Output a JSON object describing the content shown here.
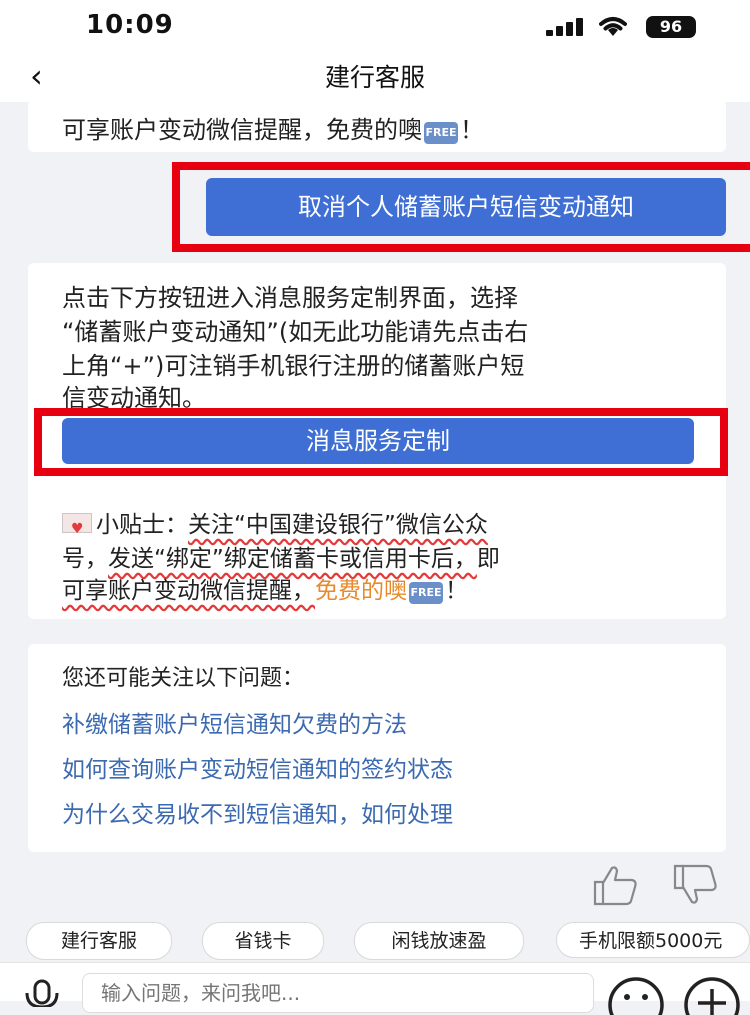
{
  "status": {
    "time": "10:09",
    "battery": "96"
  },
  "nav": {
    "back_icon": "‹",
    "title": "建行客服"
  },
  "card1": {
    "text_a": "可享账户变动微信提醒，免费的噢",
    "free_icon": "FREE",
    "text_b": "！"
  },
  "user_msg": {
    "label": "取消个人储蓄账户短信变动通知"
  },
  "card2": {
    "lines": [
      "点击下方按钮进入消息服务定制界面，选择",
      "“储蓄账户变动通知”(如无此功能请先点击右",
      "上角“+”)可注销手机银行注册的储蓄账户短",
      "信变动通知。"
    ],
    "button": "消息服务定制",
    "tip_prefix": "小贴士：",
    "tip_1": "关注“中国建设银行”微信公众",
    "tip_2a": "号，",
    "tip_2b": "发送“绑定”绑定储蓄卡或信用卡后，",
    "tip_2c": "即",
    "tip_3a": "可享账户变动微信提醒，",
    "tip_3b": "免费的噢",
    "tip_3c": "！"
  },
  "related": {
    "title": "您还可能关注以下问题：",
    "items": [
      "补缴储蓄账户短信通知欠费的方法",
      "如何查询账户变动短信通知的签约状态",
      "为什么交易收不到短信通知，如何处理"
    ]
  },
  "chips": [
    "建行客服",
    "省钱卡",
    "闲钱放速盈",
    "手机限额5000元"
  ],
  "input": {
    "placeholder": "输入问题，来问我吧..."
  },
  "colors": {
    "accent_blue": "#3f6fd4",
    "highlight_red": "#e60010",
    "link_blue": "#3c6ab0",
    "orange": "#e88a2a"
  }
}
